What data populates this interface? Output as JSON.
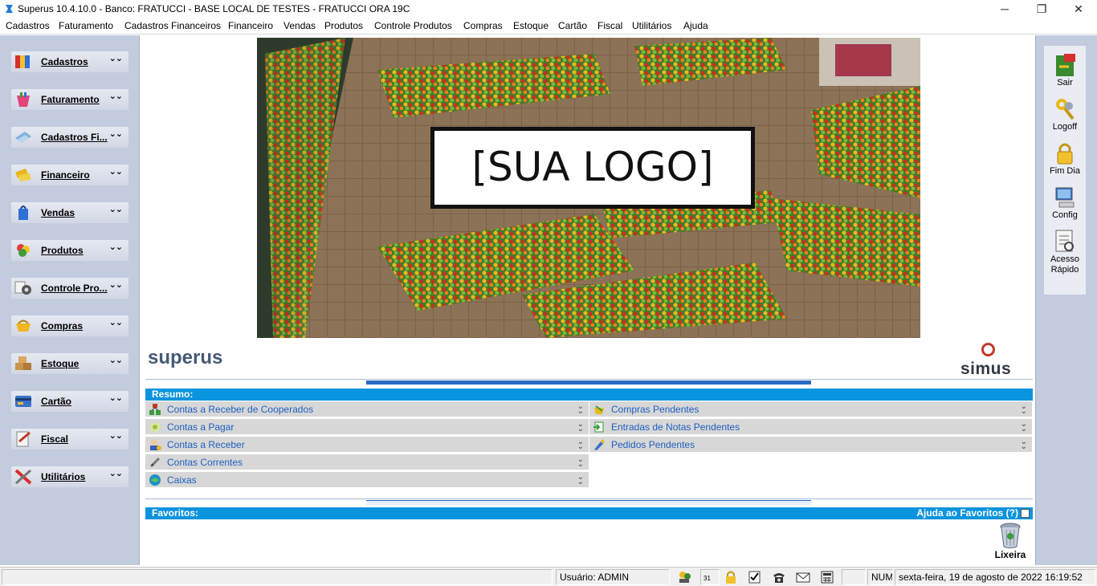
{
  "window": {
    "title": "Superus 10.4.10.0 - Banco: FRATUCCI - BASE LOCAL DE TESTES - FRATUCCI ORA 19C",
    "minimize_glyph": "─",
    "maximize_glyph": "❐",
    "close_glyph": "✕"
  },
  "menubar": {
    "items": [
      "Cadastros",
      "Faturamento",
      "Cadastros Financeiros",
      "Financeiro",
      "Vendas",
      "Produtos",
      "Controle Produtos",
      "Compras",
      "Estoque",
      "Cartão",
      "Fiscal",
      "Utilitários",
      "Ajuda"
    ]
  },
  "sidebar": {
    "items": [
      {
        "label": "Cadastros",
        "icon": "cadastros-icon"
      },
      {
        "label": "Faturamento",
        "icon": "faturamento-icon"
      },
      {
        "label": "Cadastros Fi...",
        "icon": "cadastros-financeiros-icon"
      },
      {
        "label": "Financeiro",
        "icon": "financeiro-icon"
      },
      {
        "label": "Vendas",
        "icon": "vendas-icon"
      },
      {
        "label": "Produtos",
        "icon": "produtos-icon"
      },
      {
        "label": "Controle Pro...",
        "icon": "controle-produtos-icon"
      },
      {
        "label": "Compras",
        "icon": "compras-icon"
      },
      {
        "label": "Estoque",
        "icon": "estoque-icon"
      },
      {
        "label": "Cartão",
        "icon": "cartao-icon"
      },
      {
        "label": "Fiscal",
        "icon": "fiscal-icon"
      },
      {
        "label": "Utilitários",
        "icon": "utilitarios-icon"
      }
    ],
    "chevron": "⌄⌄"
  },
  "rightbar": {
    "buttons": [
      {
        "label": "Sair",
        "icon": "exit-icon"
      },
      {
        "label": "Logoff",
        "icon": "keys-icon"
      },
      {
        "label": "Fim Dia",
        "icon": "lock-icon"
      },
      {
        "label": "Config",
        "icon": "computer-icon"
      },
      {
        "label": "Acesso Rápido",
        "icon": "quick-access-icon"
      }
    ]
  },
  "banner": {
    "logo_text": "[SUA LOGO]"
  },
  "brands": {
    "superus": "superus",
    "simus": "simus"
  },
  "resumo": {
    "header": "Resumo:",
    "left": [
      {
        "label": "Contas a Receber de Cooperados",
        "icon": "cooperados-icon"
      },
      {
        "label": "Contas a Pagar",
        "icon": "contas-pagar-icon"
      },
      {
        "label": "Contas a Receber",
        "icon": "contas-receber-icon"
      },
      {
        "label": "Contas Correntes",
        "icon": "contas-correntes-icon"
      },
      {
        "label": "Caixas",
        "icon": "caixas-icon"
      }
    ],
    "right": [
      {
        "label": "Compras Pendentes",
        "icon": "compras-pendentes-icon"
      },
      {
        "label": "Entradas de Notas Pendentes",
        "icon": "entradas-notas-icon"
      },
      {
        "label": "Pedidos Pendentes",
        "icon": "pedidos-pendentes-icon"
      }
    ]
  },
  "favoritos": {
    "header": "Favoritos:",
    "help": "Ajuda ao Favoritos (?)",
    "trash_label": "Lixeira"
  },
  "statusbar": {
    "user": "Usuário: ADMIN",
    "num": "NUM",
    "datetime": "sexta-feira, 19 de agosto de 2022 16:19:52",
    "calendar_day": "31"
  },
  "colors": {
    "sidebar_bg": "#c3cbdf",
    "accent_bar": "#0b94de",
    "link_blue": "#1f5fbf",
    "row_gray": "#d7d7d7"
  }
}
